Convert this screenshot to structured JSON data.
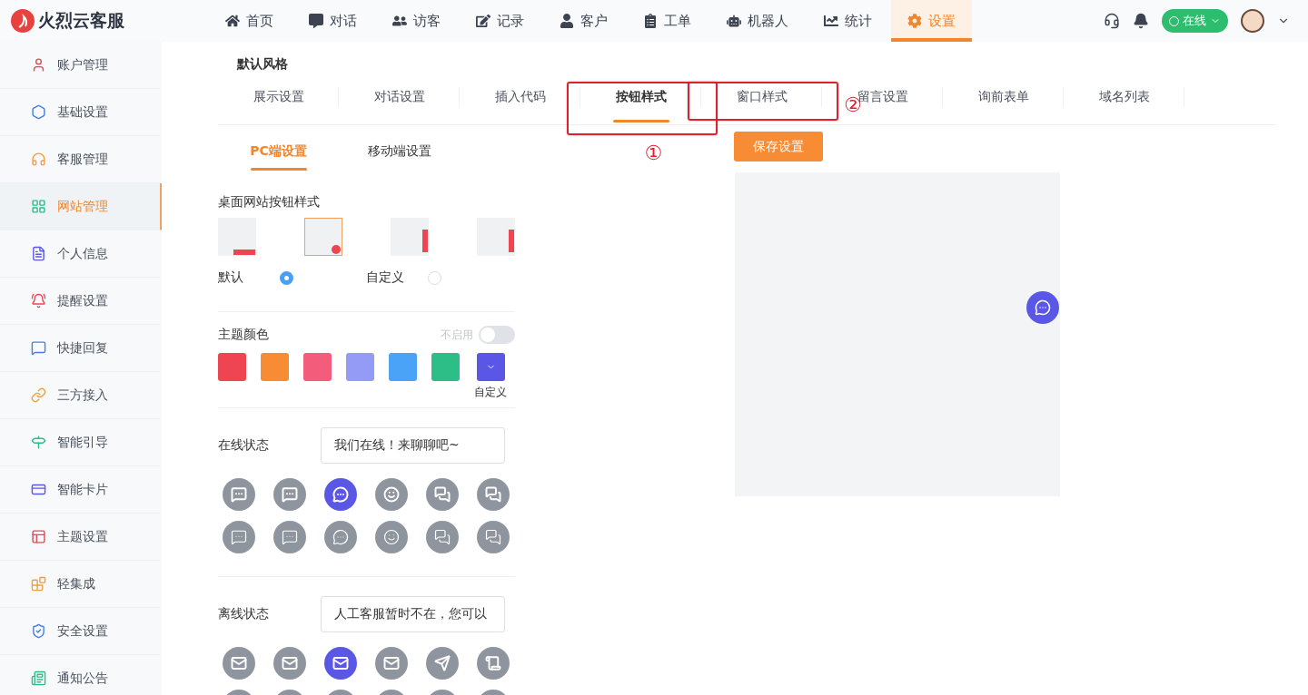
{
  "app": {
    "name": "火烈云客服"
  },
  "nav": [
    {
      "label": "首页",
      "selected": false
    },
    {
      "label": "对话",
      "selected": false
    },
    {
      "label": "访客",
      "selected": false
    },
    {
      "label": "记录",
      "selected": false
    },
    {
      "label": "客户",
      "selected": false
    },
    {
      "label": "工单",
      "selected": false
    },
    {
      "label": "机器人",
      "selected": false
    },
    {
      "label": "统计",
      "selected": false
    },
    {
      "label": "设置",
      "selected": true
    }
  ],
  "header": {
    "status": "在线"
  },
  "sidebar": [
    {
      "label": "账户管理",
      "selected": false
    },
    {
      "label": "基础设置",
      "selected": false
    },
    {
      "label": "客服管理",
      "selected": false
    },
    {
      "label": "网站管理",
      "selected": true
    },
    {
      "label": "个人信息",
      "selected": false
    },
    {
      "label": "提醒设置",
      "selected": false
    },
    {
      "label": "快捷回复",
      "selected": false
    },
    {
      "label": "三方接入",
      "selected": false
    },
    {
      "label": "智能引导",
      "selected": false
    },
    {
      "label": "智能卡片",
      "selected": false
    },
    {
      "label": "主题设置",
      "selected": false
    },
    {
      "label": "轻集成",
      "selected": false
    },
    {
      "label": "安全设置",
      "selected": false
    },
    {
      "label": "通知公告",
      "selected": false
    }
  ],
  "section_title": "默认风格",
  "tabs": [
    {
      "label": "展示设置",
      "selected": false
    },
    {
      "label": "对话设置",
      "selected": false
    },
    {
      "label": "插入代码",
      "selected": false
    },
    {
      "label": "按钮样式",
      "selected": true,
      "annotation": {
        "label": "①",
        "kind": "below"
      }
    },
    {
      "label": "窗口样式",
      "selected": false,
      "annotation": {
        "label": "②",
        "kind": "right"
      }
    },
    {
      "label": "留言设置",
      "selected": false
    },
    {
      "label": "询前表单",
      "selected": false
    },
    {
      "label": "域名列表",
      "selected": false
    }
  ],
  "subtabs": [
    {
      "label": "PC端设置",
      "selected": true
    },
    {
      "label": "移动端设置",
      "selected": false
    }
  ],
  "button_style": {
    "title": "桌面网站按钮样式",
    "thumbnails": [
      {
        "kind": "bar-bottom",
        "selected": false
      },
      {
        "kind": "dot",
        "selected": true
      },
      {
        "kind": "bar-right",
        "selected": false
      },
      {
        "kind": "bar-edge",
        "selected": false
      }
    ],
    "options": [
      {
        "label": "默认",
        "selected": true
      },
      {
        "label": "自定义",
        "selected": false
      }
    ]
  },
  "theme": {
    "title": "主题颜色",
    "toggle": {
      "label": "不启用",
      "on": false
    },
    "swatches": [
      {
        "kind": "plain",
        "color": "#ef4452"
      },
      {
        "kind": "plain",
        "color": "#f78c35"
      },
      {
        "kind": "plain",
        "color": "#f45c7c"
      },
      {
        "kind": "plain",
        "color": "#949bf7"
      },
      {
        "kind": "plain",
        "color": "#4aa3f7"
      },
      {
        "kind": "plain",
        "color": "#2dbd86"
      },
      {
        "kind": "custom",
        "color": "#5b57e6",
        "label": "自定义"
      }
    ]
  },
  "online": {
    "label": "在线状态",
    "value": "我们在线！来聊聊吧~",
    "icons": [
      {
        "selected": false
      },
      {
        "selected": false
      },
      {
        "selected": true
      },
      {
        "selected": false
      },
      {
        "selected": false
      },
      {
        "selected": false
      },
      {
        "selected": false
      },
      {
        "selected": false
      },
      {
        "selected": false
      },
      {
        "selected": false
      },
      {
        "selected": false
      },
      {
        "selected": false
      }
    ]
  },
  "offline": {
    "label": "离线状态",
    "value": "人工客服暂时不在，您可以",
    "icons": [
      {
        "selected": false
      },
      {
        "selected": false
      },
      {
        "selected": true
      },
      {
        "selected": false
      },
      {
        "selected": false
      },
      {
        "selected": false
      },
      {
        "selected": false
      },
      {
        "selected": false
      },
      {
        "selected": false
      },
      {
        "selected": false
      },
      {
        "selected": false
      },
      {
        "selected": false
      }
    ]
  },
  "save_button": "保存设置"
}
